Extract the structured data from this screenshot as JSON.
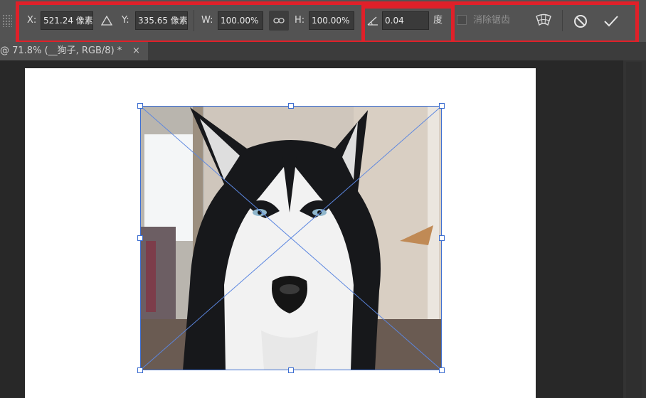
{
  "options_bar": {
    "x_label": "X:",
    "x_value": "521.24 像素",
    "y_label": "Y:",
    "y_value": "335.65 像素",
    "w_label": "W:",
    "w_value": "100.00%",
    "h_label": "H:",
    "h_value": "100.00%",
    "angle_value": "0.04",
    "angle_unit": "度",
    "antialias_label": "消除锯齿",
    "icons": [
      "reference-point-icon",
      "link-chain-icon",
      "angle-icon",
      "warp-icon",
      "cancel-icon",
      "commit-check-icon"
    ]
  },
  "document_tab": {
    "title": "@ 71.8% (__狗子, RGB/8) *",
    "close_glyph": "×"
  },
  "canvas": {
    "image_subject": "husky-dog-photo"
  },
  "colors": {
    "highlight_red": "#e02029",
    "transform_blue": "#3e6fd1",
    "toolbar_bg": "#535353"
  }
}
